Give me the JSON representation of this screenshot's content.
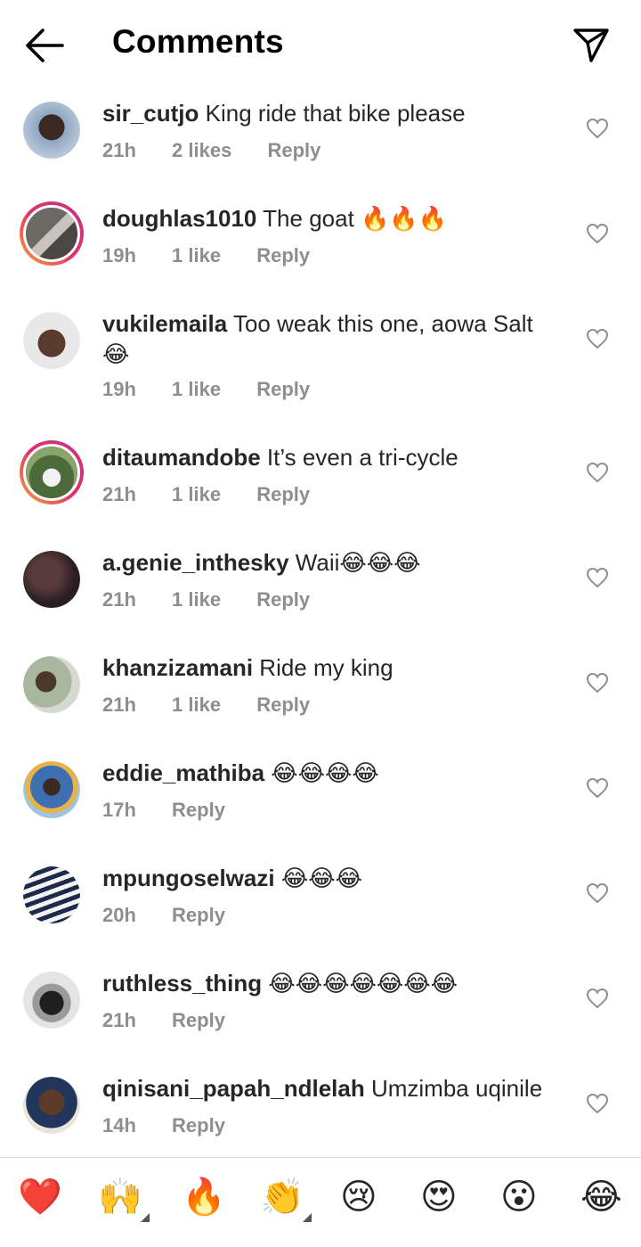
{
  "header": {
    "title": "Comments"
  },
  "comments": [
    {
      "user": "sir_cutjo",
      "text": "King ride that bike please",
      "time": "21h",
      "likes": "2 likes",
      "reply": "Reply"
    },
    {
      "user": "doughlas1010",
      "text": "The goat 🔥🔥🔥",
      "time": "19h",
      "likes": "1 like",
      "reply": "Reply"
    },
    {
      "user": "vukilemaila",
      "text": "Too weak this one, aowa Salt 😂",
      "time": "19h",
      "likes": "1 like",
      "reply": "Reply"
    },
    {
      "user": "ditaumandobe",
      "text": "It’s even a tri-cycle",
      "time": "21h",
      "likes": "1 like",
      "reply": "Reply"
    },
    {
      "user": "a.genie_inthesky",
      "text": "Waii😂😂😂",
      "time": "21h",
      "likes": "1 like",
      "reply": "Reply"
    },
    {
      "user": "khanzizamani",
      "text": "Ride my king",
      "time": "21h",
      "likes": "1 like",
      "reply": "Reply"
    },
    {
      "user": "eddie_mathiba",
      "text": "😂😂😂😂",
      "time": "17h",
      "reply": "Reply"
    },
    {
      "user": "mpungoselwazi",
      "text": "😂😂😂",
      "time": "20h",
      "reply": "Reply"
    },
    {
      "user": "ruthless_thing",
      "text": "😂😂😂😂😂😂😂",
      "time": "21h",
      "reply": "Reply"
    },
    {
      "user": "qinisani_papah_ndlelah",
      "text": "Umzimba uqinile",
      "time": "14h",
      "reply": "Reply"
    }
  ],
  "reactions": [
    "❤️",
    "🙌",
    "🔥",
    "👏",
    "😢",
    "😍",
    "😮",
    "😂"
  ],
  "colors": {
    "meta": "#8e8e8e",
    "ring_start": "#f9a33a",
    "ring_end": "#c13584",
    "text": "#262626"
  }
}
